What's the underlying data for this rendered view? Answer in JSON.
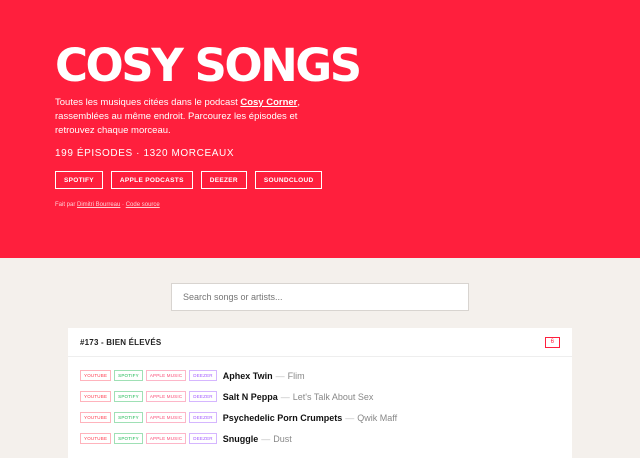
{
  "hero": {
    "title": "COSY SONGS",
    "desc_before": "Toutes les musiques citées dans le podcast ",
    "desc_link": "Cosy Corner",
    "desc_after": ", rassemblées au même endroit. Parcourez les épisodes et retrouvez chaque morceau.",
    "counts": "199 ÉPISODES · 1320 MORCEAUX",
    "platforms": [
      "SPOTIFY",
      "APPLE PODCASTS",
      "DEEZER",
      "SOUNDCLOUD"
    ],
    "credit_prefix": "Fait par ",
    "credit_author": "Dimitri Bourreau",
    "credit_sep": " · ",
    "credit_source": "Code source"
  },
  "search": {
    "placeholder": "Search songs or artists..."
  },
  "episode": {
    "title": "#173 - BIEN ÉLEVÉS",
    "count": "6",
    "badges": {
      "youtube": "YOUTUBE",
      "spotify": "SPOTIFY",
      "apple": "APPLE MUSIC",
      "deezer": "DEEZER"
    },
    "separator": "—",
    "songs": [
      {
        "artist": "Aphex Twin",
        "track": "Flim"
      },
      {
        "artist": "Salt N Peppa",
        "track": "Let's Talk About Sex"
      },
      {
        "artist": "Psychedelic Porn Crumpets",
        "track": "Qwik Maff"
      },
      {
        "artist": "Snuggle",
        "track": "Dust"
      }
    ]
  },
  "colors": {
    "accent": "#ff1f3d",
    "background": "#f4f0ec"
  }
}
